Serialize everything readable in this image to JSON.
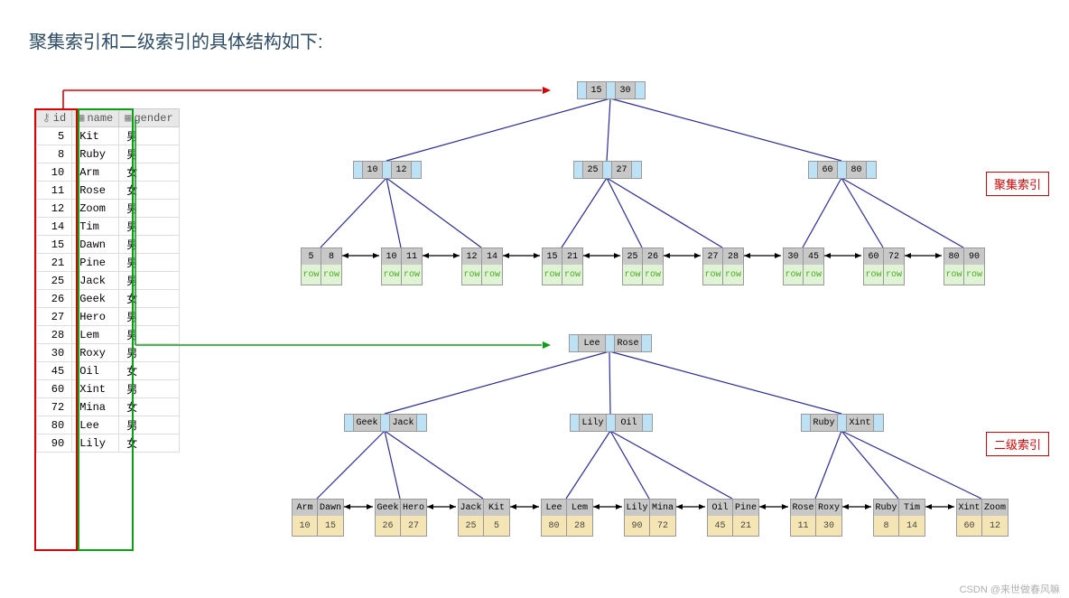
{
  "title": "聚集索引和二级索引的具体结构如下:",
  "table": {
    "headers": {
      "id": "id",
      "name": "name",
      "gender": "gender"
    },
    "rows": [
      {
        "id": 5,
        "name": "Kit",
        "gender": "男"
      },
      {
        "id": 8,
        "name": "Ruby",
        "gender": "男"
      },
      {
        "id": 10,
        "name": "Arm",
        "gender": "女"
      },
      {
        "id": 11,
        "name": "Rose",
        "gender": "女"
      },
      {
        "id": 12,
        "name": "Zoom",
        "gender": "男"
      },
      {
        "id": 14,
        "name": "Tim",
        "gender": "男"
      },
      {
        "id": 15,
        "name": "Dawn",
        "gender": "男"
      },
      {
        "id": 21,
        "name": "Pine",
        "gender": "男"
      },
      {
        "id": 25,
        "name": "Jack",
        "gender": "男"
      },
      {
        "id": 26,
        "name": "Geek",
        "gender": "女"
      },
      {
        "id": 27,
        "name": "Hero",
        "gender": "男"
      },
      {
        "id": 28,
        "name": "Lem",
        "gender": "男"
      },
      {
        "id": 30,
        "name": "Roxy",
        "gender": "男"
      },
      {
        "id": 45,
        "name": "Oil",
        "gender": "女"
      },
      {
        "id": 60,
        "name": "Xint",
        "gender": "男"
      },
      {
        "id": 72,
        "name": "Mina",
        "gender": "女"
      },
      {
        "id": 80,
        "name": "Lee",
        "gender": "男"
      },
      {
        "id": 90,
        "name": "Lily",
        "gender": "女"
      }
    ]
  },
  "labels": {
    "cluster": "聚集索引",
    "secondary": "二级索引",
    "row": "row"
  },
  "cluster_tree": {
    "root": [
      15,
      30
    ],
    "level1": [
      [
        10,
        12
      ],
      [
        25,
        27
      ],
      [
        60,
        80
      ]
    ],
    "leaves": [
      {
        "k": [
          5,
          8
        ],
        "v": [
          "row",
          "row"
        ]
      },
      {
        "k": [
          10,
          11
        ],
        "v": [
          "row",
          "row"
        ]
      },
      {
        "k": [
          12,
          14
        ],
        "v": [
          "row",
          "row"
        ]
      },
      {
        "k": [
          15,
          21
        ],
        "v": [
          "row",
          "row"
        ]
      },
      {
        "k": [
          25,
          26
        ],
        "v": [
          "row",
          "row"
        ]
      },
      {
        "k": [
          27,
          28
        ],
        "v": [
          "row",
          "row"
        ]
      },
      {
        "k": [
          30,
          45
        ],
        "v": [
          "row",
          "row"
        ]
      },
      {
        "k": [
          60,
          72
        ],
        "v": [
          "row",
          "row"
        ]
      },
      {
        "k": [
          80,
          90
        ],
        "v": [
          "row",
          "row"
        ]
      }
    ]
  },
  "secondary_tree": {
    "root": [
      "Lee",
      "Rose"
    ],
    "level1": [
      [
        "Geek",
        "Jack"
      ],
      [
        "Lily",
        "Oil"
      ],
      [
        "Ruby",
        "Xint"
      ]
    ],
    "leaves": [
      {
        "k": [
          "Arm",
          "Dawn"
        ],
        "v": [
          10,
          15
        ]
      },
      {
        "k": [
          "Geek",
          "Hero"
        ],
        "v": [
          26,
          27
        ]
      },
      {
        "k": [
          "Jack",
          "Kit"
        ],
        "v": [
          25,
          5
        ]
      },
      {
        "k": [
          "Lee",
          "Lem"
        ],
        "v": [
          80,
          28
        ]
      },
      {
        "k": [
          "Lily",
          "Mina"
        ],
        "v": [
          90,
          72
        ]
      },
      {
        "k": [
          "Oil",
          "Pine"
        ],
        "v": [
          45,
          21
        ]
      },
      {
        "k": [
          "Rose",
          "Roxy"
        ],
        "v": [
          11,
          30
        ]
      },
      {
        "k": [
          "Ruby",
          "Tim"
        ],
        "v": [
          8,
          14
        ]
      },
      {
        "k": [
          "Xint",
          "Zoom"
        ],
        "v": [
          60,
          12
        ]
      }
    ]
  },
  "watermark": "CSDN @来世做春风嘛",
  "chart_data": {
    "type": "table",
    "description": "DB index B+tree diagram showing clustered index keyed by id and secondary index keyed by name storing id pointers"
  }
}
